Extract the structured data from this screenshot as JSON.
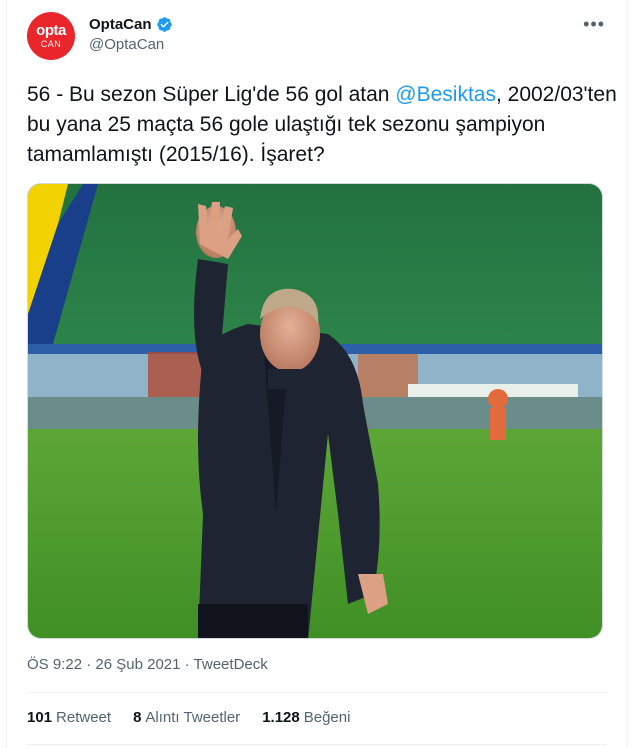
{
  "author": {
    "display_name": "OptaCan",
    "handle": "@OptaCan",
    "avatar_top": "opta",
    "avatar_bottom": "CAN"
  },
  "tweet": {
    "text_before": "56 - Bu sezon Süper Lig'de 56 gol atan ",
    "mention": "@Besiktas",
    "text_after": ", 2002/03'ten bu yana 25 maçta 56 gole ulaştığı tek sezonu şampiyon tamamlamıştı (2015/16). İşaret?"
  },
  "meta": {
    "time": "ÖS 9:22",
    "sep1": "·",
    "date": "26 Şub 2021",
    "sep2": "·",
    "source": "TweetDeck"
  },
  "stats": {
    "retweets_count": "101",
    "retweets_label": "Retweet",
    "quotes_count": "8",
    "quotes_label": "Alıntı Tweetler",
    "likes_count": "1.128",
    "likes_label": "Beğeni"
  },
  "icons": {
    "verified": "verified-badge-icon",
    "more": "more-horizontal-icon"
  },
  "colors": {
    "accent": "#1d9bf0",
    "avatar": "#e8262c",
    "muted": "#536471"
  }
}
